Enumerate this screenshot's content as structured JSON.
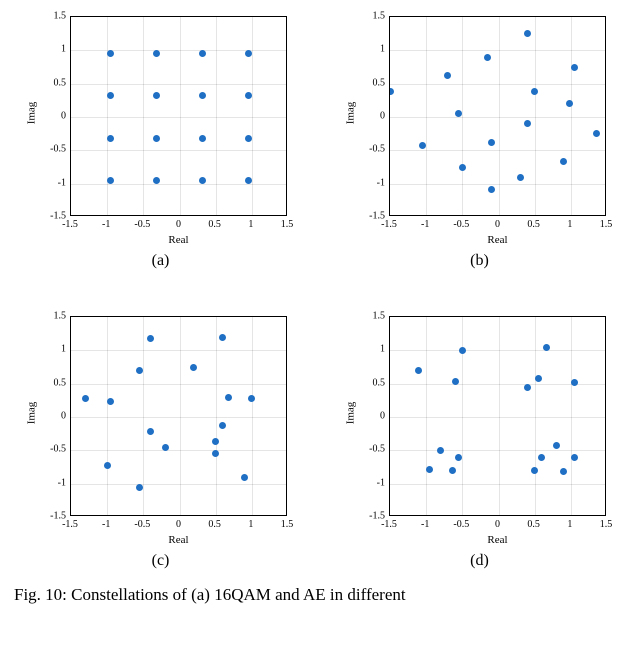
{
  "chart_data": [
    {
      "type": "scatter",
      "title": "",
      "xlabel": "Real",
      "ylabel": "Imag",
      "xlim": [
        -1.5,
        1.5
      ],
      "ylim": [
        -1.5,
        1.5
      ],
      "xticks": [
        -1.5,
        -1,
        -0.5,
        0,
        0.5,
        1,
        1.5
      ],
      "yticks": [
        -1.5,
        -1,
        -0.5,
        0,
        0.5,
        1,
        1.5
      ],
      "sub_caption": "(a)",
      "points": [
        {
          "x": -0.95,
          "y": 0.95
        },
        {
          "x": -0.32,
          "y": 0.95
        },
        {
          "x": 0.32,
          "y": 0.95
        },
        {
          "x": 0.95,
          "y": 0.95
        },
        {
          "x": -0.95,
          "y": 0.32
        },
        {
          "x": -0.32,
          "y": 0.32
        },
        {
          "x": 0.32,
          "y": 0.32
        },
        {
          "x": 0.95,
          "y": 0.32
        },
        {
          "x": -0.95,
          "y": -0.32
        },
        {
          "x": -0.32,
          "y": -0.32
        },
        {
          "x": 0.32,
          "y": -0.32
        },
        {
          "x": 0.95,
          "y": -0.32
        },
        {
          "x": -0.95,
          "y": -0.95
        },
        {
          "x": -0.32,
          "y": -0.95
        },
        {
          "x": 0.32,
          "y": -0.95
        },
        {
          "x": 0.95,
          "y": -0.95
        }
      ]
    },
    {
      "type": "scatter",
      "title": "",
      "xlabel": "Real",
      "ylabel": "Imag",
      "xlim": [
        -1.5,
        1.5
      ],
      "ylim": [
        -1.5,
        1.5
      ],
      "xticks": [
        -1.5,
        -1,
        -0.5,
        0,
        0.5,
        1,
        1.5
      ],
      "yticks": [
        -1.5,
        -1,
        -0.5,
        0,
        0.5,
        1,
        1.5
      ],
      "sub_caption": "(b)",
      "points": [
        {
          "x": 0.4,
          "y": 1.25
        },
        {
          "x": -0.15,
          "y": 0.9
        },
        {
          "x": -0.7,
          "y": 0.63
        },
        {
          "x": 1.05,
          "y": 0.74
        },
        {
          "x": -1.5,
          "y": 0.38
        },
        {
          "x": 0.5,
          "y": 0.38
        },
        {
          "x": 0.98,
          "y": 0.2
        },
        {
          "x": -0.55,
          "y": 0.05
        },
        {
          "x": 0.4,
          "y": -0.1
        },
        {
          "x": 1.35,
          "y": -0.25
        },
        {
          "x": -0.1,
          "y": -0.38
        },
        {
          "x": -1.05,
          "y": -0.43
        },
        {
          "x": 0.9,
          "y": -0.66
        },
        {
          "x": -0.5,
          "y": -0.75
        },
        {
          "x": 0.3,
          "y": -0.9
        },
        {
          "x": -0.1,
          "y": -1.08
        }
      ]
    },
    {
      "type": "scatter",
      "title": "",
      "xlabel": "Real",
      "ylabel": "Imag",
      "xlim": [
        -1.5,
        1.5
      ],
      "ylim": [
        -1.5,
        1.5
      ],
      "xticks": [
        -1.5,
        -1,
        -0.5,
        0,
        0.5,
        1,
        1.5
      ],
      "yticks": [
        -1.5,
        -1,
        -0.5,
        0,
        0.5,
        1,
        1.5
      ],
      "sub_caption": "(c)",
      "points": [
        {
          "x": -0.4,
          "y": 1.18
        },
        {
          "x": 0.6,
          "y": 1.2
        },
        {
          "x": 0.2,
          "y": 0.75
        },
        {
          "x": -0.55,
          "y": 0.7
        },
        {
          "x": 0.68,
          "y": 0.3
        },
        {
          "x": -1.3,
          "y": 0.28
        },
        {
          "x": -0.95,
          "y": 0.24
        },
        {
          "x": 1.0,
          "y": 0.28
        },
        {
          "x": 0.6,
          "y": -0.12
        },
        {
          "x": -0.4,
          "y": -0.22
        },
        {
          "x": 0.5,
          "y": -0.37
        },
        {
          "x": -0.2,
          "y": -0.45
        },
        {
          "x": 0.5,
          "y": -0.55
        },
        {
          "x": -1.0,
          "y": -0.72
        },
        {
          "x": 0.9,
          "y": -0.9
        },
        {
          "x": -0.55,
          "y": -1.05
        }
      ]
    },
    {
      "type": "scatter",
      "title": "",
      "xlabel": "Real",
      "ylabel": "Imag",
      "xlim": [
        -1.5,
        1.5
      ],
      "ylim": [
        -1.5,
        1.5
      ],
      "xticks": [
        -1.5,
        -1,
        -0.5,
        0,
        0.5,
        1,
        1.5
      ],
      "yticks": [
        -1.5,
        -1,
        -0.5,
        0,
        0.5,
        1,
        1.5
      ],
      "sub_caption": "(d)",
      "points": [
        {
          "x": 0.67,
          "y": 1.05
        },
        {
          "x": -1.1,
          "y": 0.7
        },
        {
          "x": 0.55,
          "y": 0.58
        },
        {
          "x": -0.6,
          "y": 0.53
        },
        {
          "x": 1.05,
          "y": 0.52
        },
        {
          "x": 0.4,
          "y": 0.45
        },
        {
          "x": -0.5,
          "y": 1.0
        },
        {
          "x": 0.8,
          "y": -0.42
        },
        {
          "x": -0.8,
          "y": -0.5
        },
        {
          "x": -0.55,
          "y": -0.6
        },
        {
          "x": 0.6,
          "y": -0.6
        },
        {
          "x": -0.95,
          "y": -0.78
        },
        {
          "x": -0.63,
          "y": -0.8
        },
        {
          "x": 0.5,
          "y": -0.8
        },
        {
          "x": 0.9,
          "y": -0.82
        },
        {
          "x": 1.05,
          "y": -0.6
        }
      ]
    }
  ],
  "figure_caption": "Fig. 10: Constellations of (a) 16QAM and AE in different"
}
